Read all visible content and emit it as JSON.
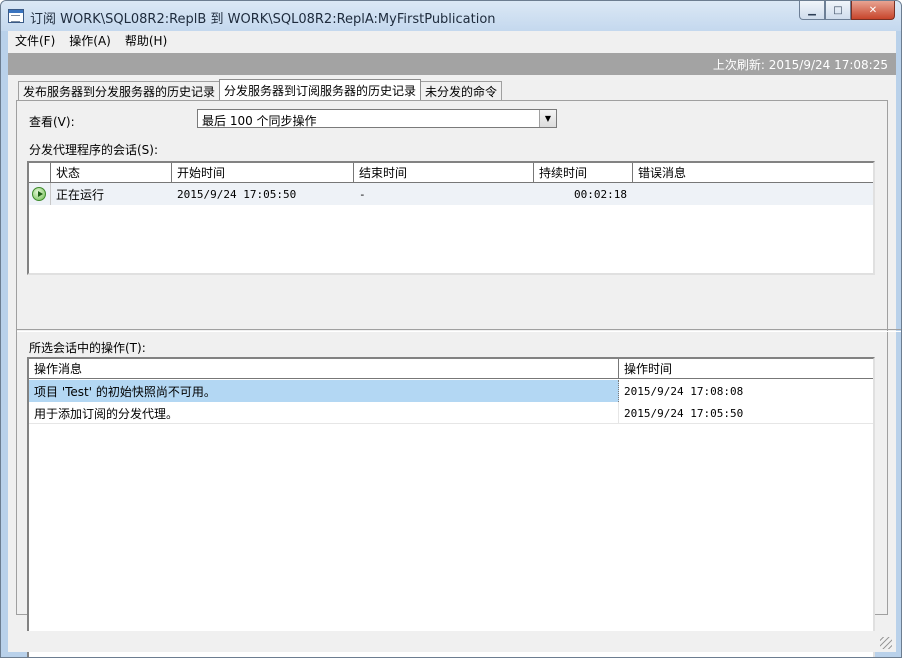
{
  "window": {
    "title": "订阅 WORK\\SQL08R2:ReplB 到 WORK\\SQL08R2:ReplA:MyFirstPublication",
    "min_label": "▁",
    "max_label": "□",
    "close_label": "✕"
  },
  "menu": [
    "文件(F)",
    "操作(A)",
    "帮助(H)"
  ],
  "refresh": {
    "text": "上次刷新: 2015/9/24 17:08:25"
  },
  "tabs": [
    {
      "label": "发布服务器到分发服务器的历史记录",
      "active": false
    },
    {
      "label": "分发服务器到订阅服务器的历史记录",
      "active": true
    },
    {
      "label": "未分发的命令",
      "active": false
    }
  ],
  "view": {
    "label": "查看(V):",
    "selected": "最后 100 个同步操作"
  },
  "sessions": {
    "label": "分发代理程序的会话(S):",
    "columns": [
      "状态",
      "开始时间",
      "结束时间",
      "持续时间",
      "错误消息"
    ],
    "rows": [
      {
        "icon": "running-icon",
        "status": "正在运行",
        "start": "2015/9/24 17:05:50",
        "end": "-",
        "duration": "00:02:18",
        "error": ""
      }
    ]
  },
  "actions": {
    "label": "所选会话中的操作(T):",
    "columns": [
      "操作消息",
      "操作时间"
    ],
    "rows": [
      {
        "message": "项目 'Test' 的初始快照尚不可用。",
        "time": "2015/9/24 17:08:08",
        "selected": true
      },
      {
        "message": "用于添加订阅的分发代理。",
        "time": "2015/9/24 17:05:50",
        "selected": false
      }
    ]
  },
  "colors": {
    "selection": "#b3d7f3",
    "refresh_bar": "#a3a3a3",
    "frame": "#b9d1ea"
  }
}
